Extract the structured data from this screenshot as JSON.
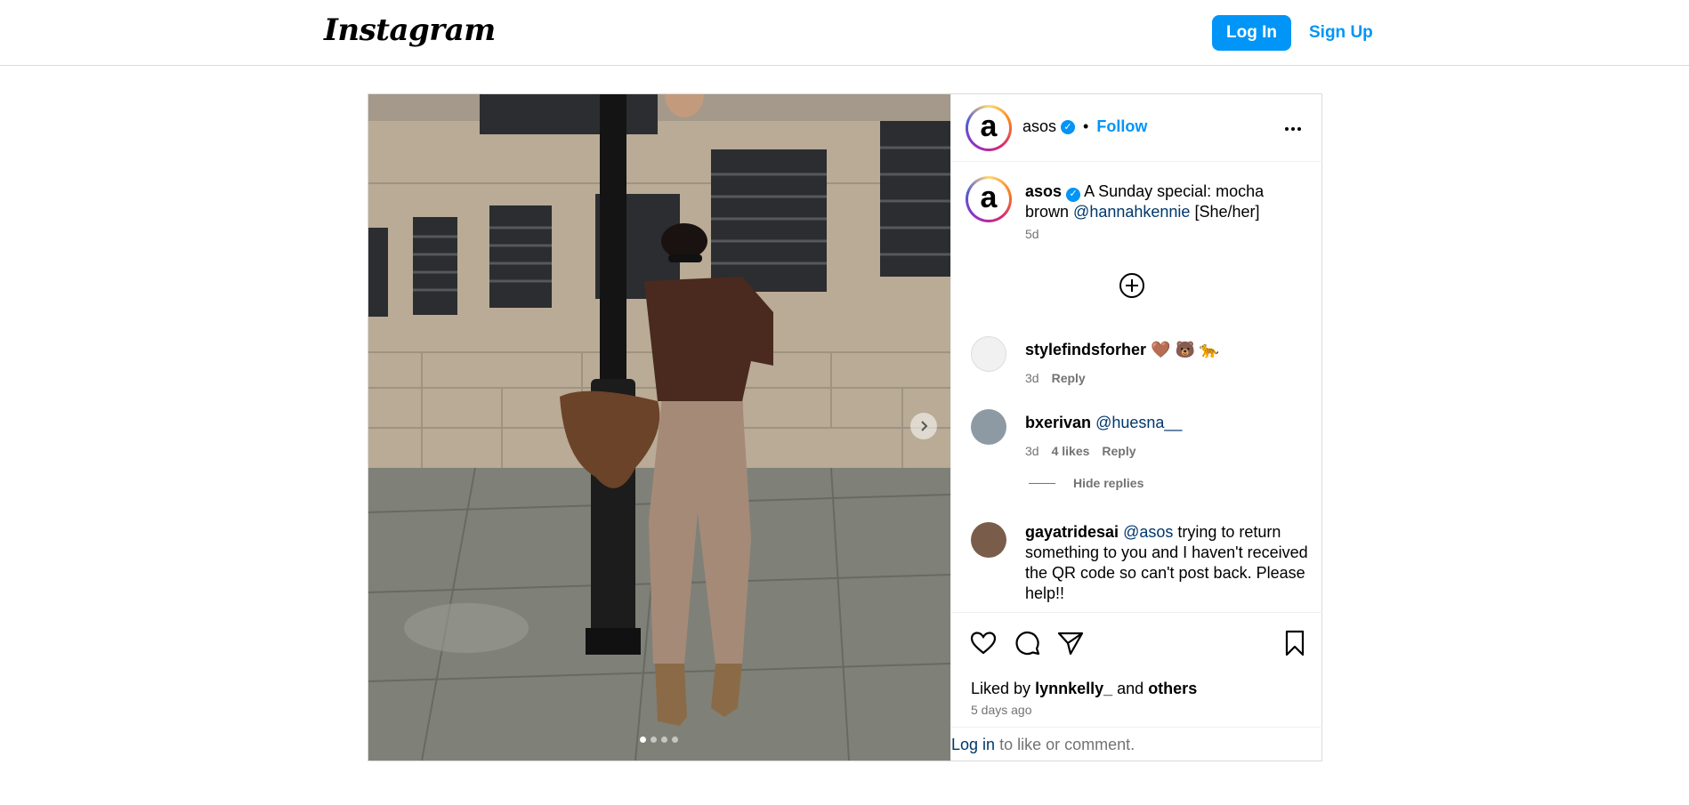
{
  "header": {
    "logo": "Instagram",
    "login_label": "Log In",
    "signup_label": "Sign Up"
  },
  "post": {
    "author": "asos",
    "author_initial": "a",
    "separator": "•",
    "follow_label": "Follow",
    "carousel": {
      "total_slides": 4,
      "active_slide": 1
    },
    "caption": {
      "user": "asos",
      "text_before": "A Sunday special: mocha brown",
      "mention": "@hannahkennie",
      "text_after": "[She/her]",
      "time": "5d"
    },
    "comments": [
      {
        "user": "stylefindsforher",
        "text": "🤎 🐻 🐆",
        "time": "3d",
        "reply_label": "Reply"
      },
      {
        "user": "bxerivan",
        "mention": "@huesna__",
        "time": "3d",
        "likes": "4 likes",
        "reply_label": "Reply"
      },
      {
        "user": "gayatridesai",
        "mention": "@asos",
        "text": "trying to return something to you and I haven't received the QR code so can't post back. Please help!!"
      }
    ],
    "hide_replies_label": "Hide replies",
    "liked_by_prefix": "Liked by",
    "liked_by_user": "lynnkelly_",
    "liked_by_and": "and",
    "liked_by_others": "others",
    "posted_ago": "5 days ago",
    "login_link": "Log in",
    "login_suffix": "to like or comment."
  },
  "colors": {
    "accent": "#0095f6",
    "mention": "#00376b",
    "muted": "#737373",
    "border": "#dbdbdb"
  }
}
